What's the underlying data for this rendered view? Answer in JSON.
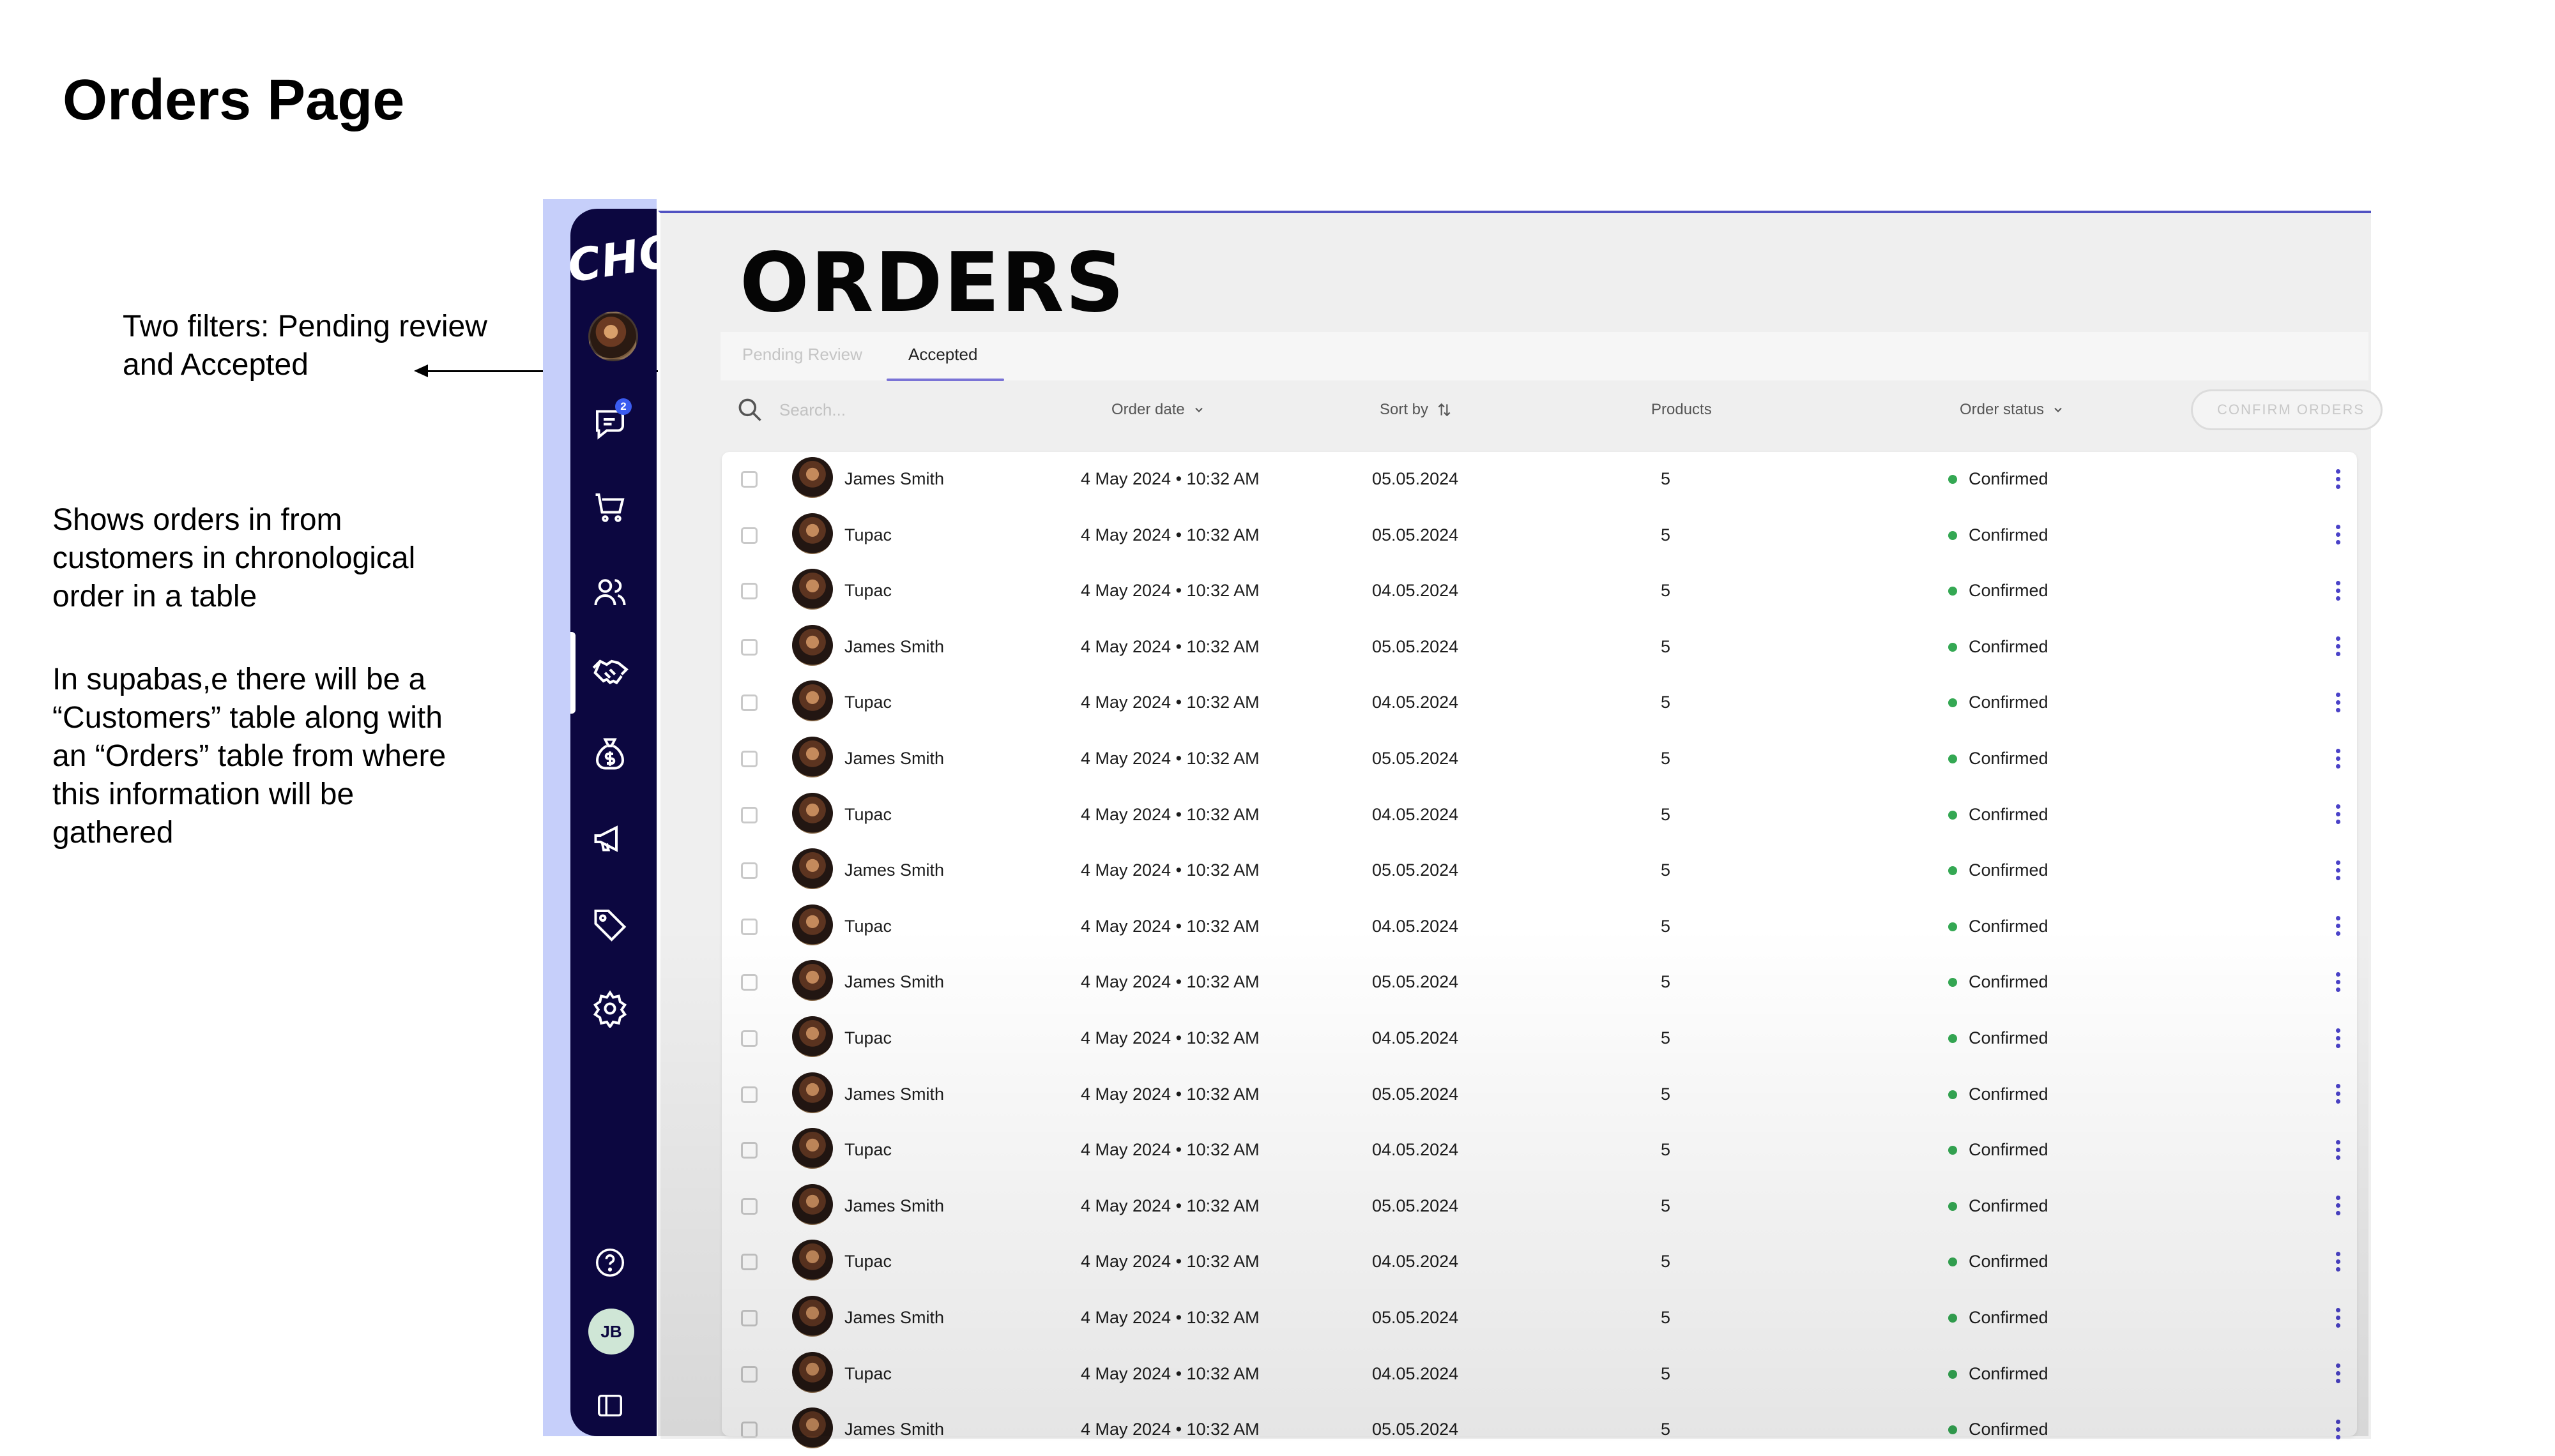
{
  "slide": {
    "title": "Orders Page",
    "note_filters": "Two filters: Pending review and Accepted",
    "note_shows": "Shows orders in from customers in chronological order in a table",
    "note_supabase": "In supabas,e there will be a “Customers” table along with an “Orders” table from where this information will be gathered"
  },
  "sidebar": {
    "logo": "CHOCO",
    "notification_count": "2",
    "user_initials": "JB",
    "icons": [
      "profile-avatar",
      "chat-icon",
      "cart-icon",
      "users-icon",
      "handshake-icon",
      "money-bag-icon",
      "megaphone-icon",
      "tag-icon",
      "gear-icon",
      "help-icon",
      "collapse-icon"
    ],
    "active_item": "handshake-icon"
  },
  "main": {
    "title": "ORDERS",
    "tabs": [
      {
        "label": "Pending Review",
        "active": false
      },
      {
        "label": "Accepted",
        "active": true
      }
    ],
    "search_placeholder": "Search...",
    "columns": {
      "order_date": "Order date",
      "sort_by": "Sort by",
      "products": "Products",
      "order_status": "Order status"
    },
    "confirm_button": "CONFIRM ORDERS",
    "accent_color": "#4a42c8",
    "status_color": "#34a853"
  },
  "orders": [
    {
      "name": "James Smith",
      "order_date": "4 May 2024 • 10:32 AM",
      "date": "05.05.2024",
      "products": "5",
      "status": "Confirmed"
    },
    {
      "name": "Tupac",
      "order_date": "4 May 2024 • 10:32 AM",
      "date": "05.05.2024",
      "products": "5",
      "status": "Confirmed"
    },
    {
      "name": "Tupac",
      "order_date": "4 May 2024 • 10:32 AM",
      "date": "04.05.2024",
      "products": "5",
      "status": "Confirmed"
    },
    {
      "name": "James Smith",
      "order_date": "4 May 2024 • 10:32 AM",
      "date": "05.05.2024",
      "products": "5",
      "status": "Confirmed"
    },
    {
      "name": "Tupac",
      "order_date": "4 May 2024 • 10:32 AM",
      "date": "04.05.2024",
      "products": "5",
      "status": "Confirmed"
    },
    {
      "name": "James Smith",
      "order_date": "4 May 2024 • 10:32 AM",
      "date": "05.05.2024",
      "products": "5",
      "status": "Confirmed"
    },
    {
      "name": "Tupac",
      "order_date": "4 May 2024 • 10:32 AM",
      "date": "04.05.2024",
      "products": "5",
      "status": "Confirmed"
    },
    {
      "name": "James Smith",
      "order_date": "4 May 2024 • 10:32 AM",
      "date": "05.05.2024",
      "products": "5",
      "status": "Confirmed"
    },
    {
      "name": "Tupac",
      "order_date": "4 May 2024 • 10:32 AM",
      "date": "04.05.2024",
      "products": "5",
      "status": "Confirmed"
    },
    {
      "name": "James Smith",
      "order_date": "4 May 2024 • 10:32 AM",
      "date": "05.05.2024",
      "products": "5",
      "status": "Confirmed"
    },
    {
      "name": "Tupac",
      "order_date": "4 May 2024 • 10:32 AM",
      "date": "04.05.2024",
      "products": "5",
      "status": "Confirmed"
    },
    {
      "name": "James Smith",
      "order_date": "4 May 2024 • 10:32 AM",
      "date": "05.05.2024",
      "products": "5",
      "status": "Confirmed"
    },
    {
      "name": "Tupac",
      "order_date": "4 May 2024 • 10:32 AM",
      "date": "04.05.2024",
      "products": "5",
      "status": "Confirmed"
    },
    {
      "name": "James Smith",
      "order_date": "4 May 2024 • 10:32 AM",
      "date": "05.05.2024",
      "products": "5",
      "status": "Confirmed"
    },
    {
      "name": "Tupac",
      "order_date": "4 May 2024 • 10:32 AM",
      "date": "04.05.2024",
      "products": "5",
      "status": "Confirmed"
    },
    {
      "name": "James Smith",
      "order_date": "4 May 2024 • 10:32 AM",
      "date": "05.05.2024",
      "products": "5",
      "status": "Confirmed"
    },
    {
      "name": "Tupac",
      "order_date": "4 May 2024 • 10:32 AM",
      "date": "04.05.2024",
      "products": "5",
      "status": "Confirmed"
    },
    {
      "name": "James Smith",
      "order_date": "4 May 2024 • 10:32 AM",
      "date": "05.05.2024",
      "products": "5",
      "status": "Confirmed"
    }
  ]
}
